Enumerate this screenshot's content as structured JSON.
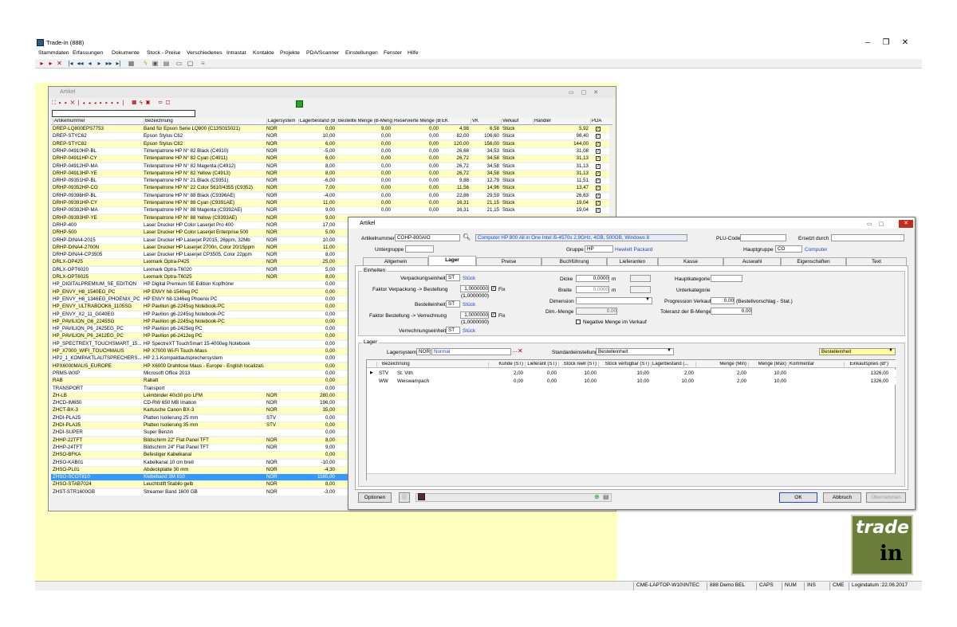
{
  "app": {
    "title": "Trade-in (888)"
  },
  "menu": [
    "Stammdaten",
    "Erfassungen",
    "Dokumente",
    "Stock - Preise",
    "Verschiedenes",
    "Intrastat",
    "Kontakte",
    "Projekte",
    "PDA/Scanner",
    "Einstellungen",
    "Fenster",
    "Hilfe"
  ],
  "list_window": {
    "title": "Artikel",
    "columns": [
      "Artikelnummer",
      "Bezeichnung",
      "Lagersystem",
      "Lagerbestand (B",
      "Bestellte Menge (B-Meng",
      "Reservierte Menge (B",
      "EK",
      "VK",
      "Verkauf",
      "Händler",
      "PDA"
    ],
    "rows": [
      [
        "DREP-LQ800EPS7753",
        "Band für Epson Serie LQ800 (C13S015021)",
        "NOR",
        "0,00",
        "9,00",
        "0,00",
        "4,98",
        "6,58",
        "Stück",
        "5,92",
        "x"
      ],
      [
        "DREP-STYC62",
        "Epson Stylus C62",
        "NOR",
        "10,00",
        "0,00",
        "0,00",
        "82,00",
        "106,60",
        "Stück",
        "98,40",
        "x"
      ],
      [
        "DREP-STYC82",
        "Epson Stylus C82",
        "NOR",
        "6,00",
        "0,00",
        "0,00",
        "120,00",
        "156,00",
        "Stück",
        "144,00",
        "x"
      ],
      [
        "DRHP-04910HP-BL",
        "Tintenpatrone HP N° 82 Black (C4910)",
        "NOR",
        "-5,00",
        "0,00",
        "0,00",
        "26,68",
        "34,53",
        "Stück",
        "31,08",
        "x"
      ],
      [
        "DRHP-04911HP-CY",
        "Tintenpatrone HP N° 82 Cyan (C4911)",
        "NOR",
        "6,00",
        "0,00",
        "0,00",
        "26,72",
        "34,58",
        "Stück",
        "31,13",
        "x"
      ],
      [
        "DRHP-04912HP-MA",
        "Tintenpatrone HP N° 82 Magenta (C4912)",
        "NOR",
        "8,00",
        "0,00",
        "0,00",
        "26,72",
        "34,58",
        "Stück",
        "31,13",
        "x"
      ],
      [
        "DRHP-04913HP-YE",
        "Tintenpatrone HP N° 82 Yellow (C4913)",
        "NOR",
        "8,00",
        "0,00",
        "0,00",
        "26,72",
        "34,58",
        "Stück",
        "31,13",
        "x"
      ],
      [
        "DRHP-09351HP-BL",
        "Tintenpatrone HP N° 21 Black (C9351)",
        "NOR",
        "-6,00",
        "0,00",
        "0,00",
        "9,88",
        "12,79",
        "Stück",
        "11,51",
        "x"
      ],
      [
        "DRHP-09352HP-CO",
        "Tintenpatrone HP N° 22 Color 5610/4355 (C9352)",
        "NOR",
        "7,00",
        "0,00",
        "0,00",
        "11,56",
        "14,96",
        "Stück",
        "13,47",
        "x"
      ],
      [
        "DRHP-09396HP-BL",
        "Tintenpatrone HP N° 88 Black (C9396AE)",
        "NOR",
        "-4,00",
        "0,00",
        "0,00",
        "22,86",
        "29,59",
        "Stück",
        "26,63",
        "x"
      ],
      [
        "DRHP-09391HP-CY",
        "Tintenpatrone HP N° 88 Cyan (C9391AE)",
        "NOR",
        "11,00",
        "0,00",
        "0,00",
        "16,31",
        "21,15",
        "Stück",
        "19,04",
        "x"
      ],
      [
        "DRHP-09392HP-MA",
        "Tintenpatrone HP N° 88 Magenta (C9392AE)",
        "NOR",
        "9,00",
        "0,00",
        "0,00",
        "16,31",
        "21,15",
        "Stück",
        "19,04",
        "x"
      ],
      [
        "DRHP-09393HP-YE",
        "Tintenpatrone HP N° 88 Yellow (C9393AE)",
        "NOR",
        "9,00",
        "",
        "",
        "",
        "",
        "",
        "",
        ""
      ],
      [
        "DRHP-400",
        "Laser Drucker HP Color Laserjet Pro 400",
        "NOR",
        "17,00",
        "",
        "",
        "",
        "",
        "",
        "",
        ""
      ],
      [
        "DRHP-500",
        "Laser Drucker HP Color Laserjet Enterprise 500",
        "NOR",
        "5,00",
        "",
        "",
        "",
        "",
        "",
        "",
        ""
      ],
      [
        "DRHP-DINA4-2015",
        "Laser Drucker HP Laserjet P2015, 26ppm, 32Mb",
        "NOR",
        "10,00",
        "",
        "",
        "",
        "",
        "",
        "",
        ""
      ],
      [
        "DRHP-DINA4-2700N",
        "Laser Drucker HP Laserjet 2700n, Color 20/15ppm",
        "NOR",
        "11,00",
        "",
        "",
        "",
        "",
        "",
        "",
        ""
      ],
      [
        "DRHP-DINA4-CP3505",
        "Laser Drucker HP Laserjet CP3505, Color 22ppm",
        "NOR",
        "8,00",
        "",
        "",
        "",
        "",
        "",
        "",
        ""
      ],
      [
        "DRLX-OP425",
        "Lexmark Optra-P425",
        "NOR",
        "25,00",
        "",
        "",
        "",
        "",
        "",
        "",
        ""
      ],
      [
        "DRLX-OPT6020",
        "Lexmark Optra-T6020",
        "NOR",
        "5,00",
        "",
        "",
        "",
        "",
        "",
        "",
        ""
      ],
      [
        "DRLX-OPT6025",
        "Lexmark Optra-T6025",
        "NOR",
        "8,00",
        "",
        "",
        "",
        "",
        "",
        "",
        ""
      ],
      [
        "HP_DIGITALPREMIUM_SE_EDITION",
        "HP Digital Premium SE Edition Kopfhörer",
        "",
        "0,00",
        "",
        "",
        "",
        "",
        "",
        "",
        ""
      ],
      [
        "HP_ENVY_H8_1540EG_PC",
        "HP ENVY h8-1540eg PC",
        "",
        "0,00",
        "",
        "",
        "",
        "",
        "",
        "",
        ""
      ],
      [
        "HP_ENVY_H8_1346EG_PHOENIX_PC",
        "HP ENVY h8-1346eg Phoenix PC",
        "",
        "0,00",
        "",
        "",
        "",
        "",
        "",
        "",
        ""
      ],
      [
        "HP_ENVY_ULTRABOOK6_1105SG",
        "HP Pavilion g6-2245sg Notebook-PC",
        "",
        "0,00",
        "",
        "",
        "",
        "",
        "",
        "",
        ""
      ],
      [
        "HP_ENVY_X2_11_G040EG",
        "HP Pavilion g6-2245sg Notebook-PC",
        "",
        "0,00",
        "",
        "",
        "",
        "",
        "",
        "",
        ""
      ],
      [
        "HP_PAVILION_G6_2245SG",
        "HP Pavilion g6-2245sg Notebook-PC",
        "",
        "0,00",
        "",
        "",
        "",
        "",
        "",
        "",
        ""
      ],
      [
        "HP_PAVILION_P6_2425EG_PC",
        "HP Pavilion p6-2425eg PC",
        "",
        "0,00",
        "",
        "",
        "",
        "",
        "",
        "",
        ""
      ],
      [
        "HP_PAVILION_P6_2412EG_PC",
        "HP Pavilion p6-2412eg PC",
        "",
        "0,00",
        "",
        "",
        "",
        "",
        "",
        "",
        ""
      ],
      [
        "HP_SPECTREXT_TOUCHSMART_15...",
        "HP SpectreXT TouchSmart 15-4000eg Notebook",
        "",
        "0,00",
        "",
        "",
        "",
        "",
        "",
        "",
        ""
      ],
      [
        "HP_X7000_WIFI_TOUCHMAUS",
        "HP X7000 Wi-Fi Touch-Maus",
        "",
        "0,00",
        "",
        "",
        "",
        "",
        "",
        "",
        ""
      ],
      [
        "HP2_1_KOMPAKTLAUTSPRECHERS...",
        "HP 2.1-Kompaktlautsprechersystem",
        "",
        "0,00",
        "",
        "",
        "",
        "",
        "",
        "",
        ""
      ],
      [
        "HPX6000MAUS_EUROPE",
        "HP X6000 Drahtlose Maus - Europe - English localizati...",
        "",
        "0,00",
        "",
        "",
        "",
        "",
        "",
        "",
        ""
      ],
      [
        "PRMS-WXP",
        "Microsoft Office 2013",
        "",
        "0,00",
        "",
        "",
        "",
        "",
        "",
        "",
        ""
      ],
      [
        "RAB",
        "Rabatt",
        "",
        "0,00",
        "",
        "",
        "",
        "",
        "",
        "",
        ""
      ],
      [
        "TRANSPORT",
        "Transport",
        "",
        "0,00",
        "",
        "",
        "",
        "",
        "",
        "",
        ""
      ],
      [
        "ZH-LB",
        "Leimbinder 40x30 pro LFM",
        "NOR",
        "280,00",
        "",
        "",
        "",
        "",
        "",
        "",
        ""
      ],
      [
        "ZHCD-IM650",
        "CD-RW 650 MB Imation",
        "NOR",
        "196,00",
        "",
        "",
        "",
        "",
        "",
        "",
        ""
      ],
      [
        "ZHCT-BX-3",
        "Kartusche Canon BX-3",
        "NOR",
        "35,00",
        "",
        "",
        "",
        "",
        "",
        "",
        ""
      ],
      [
        "ZHDI-PLA25",
        "Platten Isolierung 25 mm",
        "STV",
        "0,00",
        "",
        "",
        "",
        "",
        "",
        "",
        ""
      ],
      [
        "ZHDI-PLA35",
        "Platten Isolierung 35 mm",
        "STV",
        "0,00",
        "",
        "",
        "",
        "",
        "",
        "",
        ""
      ],
      [
        "ZHDI-SUPER",
        "Super Benzin",
        "",
        "0,00",
        "",
        "",
        "",
        "",
        "",
        "",
        ""
      ],
      [
        "ZHHP-22TFT",
        "Bildschirm 22\" Flat Panel TFT",
        "NOR",
        "8,00",
        "",
        "",
        "",
        "",
        "",
        "",
        ""
      ],
      [
        "ZHHP-24TFT",
        "Bildschirm 24\" Flat Panel TFT",
        "NOR",
        "9,00",
        "",
        "",
        "",
        "",
        "",
        "",
        ""
      ],
      [
        "ZHSO-BFKA",
        "Befestiger Kabelkanal",
        "",
        "0,00",
        "",
        "",
        "",
        "",
        "",
        "",
        ""
      ],
      [
        "ZHSO-KAB01",
        "Kabelkanal 10 cm breit",
        "NOR",
        "-10,00",
        "",
        "",
        "",
        "",
        "",
        "",
        ""
      ],
      [
        "ZHSO-PL01",
        "Abdeckplatte 30 mm",
        "NOR",
        "-4,30",
        "",
        "",
        "",
        "",
        "",
        "",
        ""
      ],
      [
        "ZHSO-SCOT810",
        "Klebeband 3M 810",
        "NOR",
        "1165,00",
        "",
        "",
        "",
        "",
        "",
        "",
        ""
      ],
      [
        "ZHSO-STAB7024",
        "Leuchtstift Stabilo gelb",
        "NOR",
        "8,00",
        "",
        "",
        "",
        "",
        "",
        "",
        ""
      ],
      [
        "ZHST-STR1600GB",
        "Streamer Band 1600 GB",
        "NOR",
        "-3,00",
        "",
        "",
        "",
        "",
        "",
        "",
        ""
      ]
    ]
  },
  "detail": {
    "title": "Artikel",
    "artikelnummer_label": "Artikelnummer",
    "artikelnummer": "COHP-800AIO",
    "beschreibung": "Computer HP 800 All in One Intel i5-4570s 2,9GHz, 4GB, 500GB, Windows 8",
    "plu_label": "PLU-Code",
    "ersetzt_label": "Ersetzt durch",
    "untergruppe_label": "Untergruppe",
    "gruppe_label": "Gruppe",
    "gruppe": "HP",
    "gruppe_text": "Hewlett Packard",
    "hauptgruppe_label": "Hauptgruppe",
    "hauptgruppe": "CO",
    "hauptgruppe_text": "Computer",
    "tabs": [
      "Allgemein",
      "Lager",
      "Preise",
      "Buchführung",
      "Lieferanten",
      "Kasse",
      "Auswahl",
      "Eigenschaften",
      "Text"
    ],
    "einheiten": {
      "title": "Einheiten",
      "verpackung_label": "Verpackungseinheit",
      "verpackung": "ST",
      "verpackung_text": "Stück",
      "faktor_vb_label": "Faktor Verpackung -> Bestellung",
      "faktor_vb": "1,0000000",
      "faktor_vb_sub": "(1,0000000)",
      "fix_label": "Fix",
      "bestell_label": "Bestelleinheit",
      "bestell": "ST",
      "bestell_text": "Stück",
      "faktor_bv_label": "Faktor Bestellung -> Verrechnung",
      "faktor_bv": "1,0000000",
      "faktor_bv_sub": "(1,0000000)",
      "verrechnung_label": "Verrechnungseinheit",
      "verrechnung": "ST",
      "verrechnung_text": "Stück",
      "dicke_label": "Dicke",
      "dicke": "0,0000",
      "breite_label": "Breite",
      "breite": "0,0000",
      "unit_m": "m",
      "dimension_label": "Dimension",
      "dimmenge_label": "Dim.-Menge",
      "dimmenge": "0,00",
      "negativ_label": "Negative Menge im Verkauf",
      "hauptkat_label": "Hauptkategorie",
      "unterkat_label": "Unterkategorie",
      "progression_label": "Progression Verkauf",
      "progression": "0,00",
      "progression_note": "(Bestellvorschlag - Stat.)",
      "toleranz_label": "Toleranz der B-Menge",
      "toleranz": "0,00"
    },
    "lager": {
      "title": "Lager",
      "lagersystem_label": "Lagersystem",
      "lagersystem": "NOR",
      "lagersystem_text": "Normal",
      "standard_label": "Standardeinstellung",
      "standard": "Bestelleinheit",
      "right_select": "Bestelleinheit",
      "columns": [
        "Bezeichnung",
        "Kunde (ST)",
        "Lieferant (ST)",
        "Stock reell (ST)",
        "Stock verfügbar (ST)",
        "Lagerbestand (...",
        "Menge (Min)",
        "Menge (Max)",
        "Kommentar",
        "Einkaufspreis (Ø\")"
      ],
      "rows": [
        [
          "STV",
          "St. Vith",
          "2,00",
          "0,00",
          "10,00",
          "10,00",
          "2,00",
          "2,00",
          "10,00",
          "",
          "1326,00"
        ],
        [
          "WW",
          "Weiswampach",
          "0,00",
          "0,00",
          "10,00",
          "10,00",
          "10,00",
          "2,00",
          "10,00",
          "",
          "1326,00"
        ]
      ]
    },
    "buttons": {
      "optionen": "Optionen",
      "ok": "OK",
      "abbruch": "Abbruch",
      "uebernehmen": "Übernehmen"
    }
  },
  "statusbar": [
    "CME-LAPTOP-W10\\INTEC",
    "888 Demo BEL",
    "CAPS",
    "NUM",
    "INS",
    "CME",
    "Logindatum :22.06.2017"
  ],
  "logo": {
    "text": "trade",
    "sub": "in"
  },
  "colors": {
    "workspace": "#ffffc0",
    "selection": "#3399ff",
    "link": "#1a4ec0",
    "logo": "#6b7f3a"
  }
}
